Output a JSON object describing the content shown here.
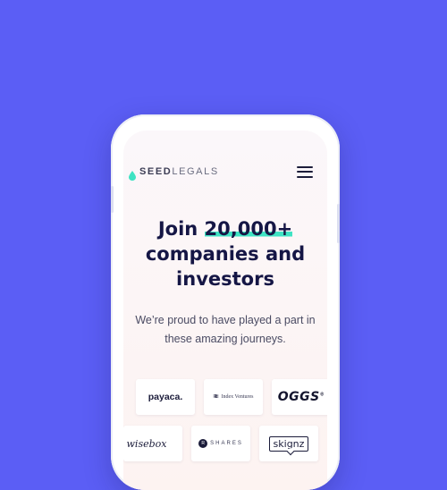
{
  "page": {
    "background_color": "#5b5ef5",
    "accent_color": "#3fe3c3"
  },
  "header": {
    "logo_seed": "SEED",
    "logo_legals": "LEGALS",
    "menu_icon": "hamburger-menu-icon"
  },
  "hero": {
    "headline_prefix": "Join ",
    "headline_highlight": "20,000+",
    "headline_line2": "companies and",
    "headline_line3": "investors",
    "subtitle_line1": "We’re proud to have played a part in",
    "subtitle_line2": "these amazing journeys."
  },
  "logos": {
    "row1": [
      "payaca.",
      "Index Ventures",
      "OGGS"
    ],
    "oggs_mark": "®",
    "row2": [
      "wisebox",
      "SHARES",
      "skignz"
    ],
    "shares_badge": "R"
  }
}
